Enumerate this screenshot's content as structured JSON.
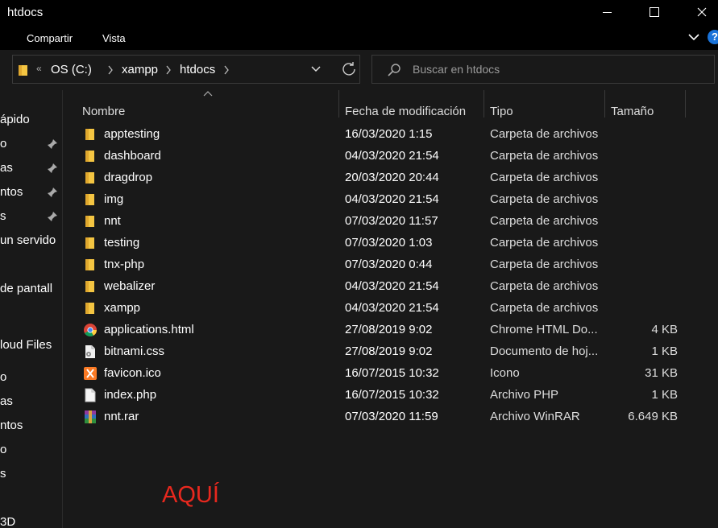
{
  "window": {
    "title": "htdocs"
  },
  "ribbon": {
    "tabs": [
      "Compartir",
      "Vista"
    ],
    "help": "?"
  },
  "address": {
    "breadcrumbs": [
      "OS (C:)",
      "xampp",
      "htdocs"
    ],
    "overflow": "«"
  },
  "search": {
    "placeholder": "Buscar en htdocs"
  },
  "nav": {
    "items": [
      {
        "label": "ápido",
        "pinned": false
      },
      {
        "label": "o",
        "pinned": true
      },
      {
        "label": "as",
        "pinned": true
      },
      {
        "label": "ntos",
        "pinned": true
      },
      {
        "label": "s",
        "pinned": true
      },
      {
        "label": " un servido",
        "pinned": false
      },
      {
        "label": " de pantall",
        "pinned": false
      },
      {
        "label": "loud Files",
        "pinned": false
      },
      {
        "label": "o",
        "pinned": false
      },
      {
        "label": "as",
        "pinned": false
      },
      {
        "label": "ntos",
        "pinned": false
      },
      {
        "label": "o",
        "pinned": false
      },
      {
        "label": "s",
        "pinned": false
      },
      {
        "label": "3D",
        "pinned": false
      }
    ]
  },
  "columns": {
    "name": "Nombre",
    "date": "Fecha de modificación",
    "type": "Tipo",
    "size": "Tamaño"
  },
  "files": [
    {
      "name": "apptesting",
      "date": "16/03/2020 1:15",
      "type": "Carpeta de archivos",
      "size": "",
      "icon": "folder-icon"
    },
    {
      "name": "dashboard",
      "date": "04/03/2020 21:54",
      "type": "Carpeta de archivos",
      "size": "",
      "icon": "folder-icon"
    },
    {
      "name": "dragdrop",
      "date": "20/03/2020 20:44",
      "type": "Carpeta de archivos",
      "size": "",
      "icon": "folder-icon"
    },
    {
      "name": "img",
      "date": "04/03/2020 21:54",
      "type": "Carpeta de archivos",
      "size": "",
      "icon": "folder-icon"
    },
    {
      "name": "nnt",
      "date": "07/03/2020 11:57",
      "type": "Carpeta de archivos",
      "size": "",
      "icon": "folder-icon"
    },
    {
      "name": "testing",
      "date": "07/03/2020 1:03",
      "type": "Carpeta de archivos",
      "size": "",
      "icon": "folder-icon"
    },
    {
      "name": "tnx-php",
      "date": "07/03/2020 0:44",
      "type": "Carpeta de archivos",
      "size": "",
      "icon": "folder-icon"
    },
    {
      "name": "webalizer",
      "date": "04/03/2020 21:54",
      "type": "Carpeta de archivos",
      "size": "",
      "icon": "folder-icon"
    },
    {
      "name": "xampp",
      "date": "04/03/2020 21:54",
      "type": "Carpeta de archivos",
      "size": "",
      "icon": "folder-icon"
    },
    {
      "name": "applications.html",
      "date": "27/08/2019 9:02",
      "type": "Chrome HTML Do...",
      "size": "4 KB",
      "icon": "chrome-icon"
    },
    {
      "name": "bitnami.css",
      "date": "27/08/2019 9:02",
      "type": "Documento de hoj...",
      "size": "1 KB",
      "icon": "css-file-icon"
    },
    {
      "name": "favicon.ico",
      "date": "16/07/2015 10:32",
      "type": "Icono",
      "size": "31 KB",
      "icon": "xampp-icon"
    },
    {
      "name": "index.php",
      "date": "16/07/2015 10:32",
      "type": "Archivo PHP",
      "size": "1 KB",
      "icon": "blank-file-icon"
    },
    {
      "name": "nnt.rar",
      "date": "07/03/2020 11:59",
      "type": "Archivo WinRAR",
      "size": "6.649 KB",
      "icon": "winrar-icon"
    }
  ],
  "annotation": "AQUÍ",
  "colors": {
    "folder": "#f4c542",
    "annotation": "#e8281e",
    "pane": "#191919"
  }
}
